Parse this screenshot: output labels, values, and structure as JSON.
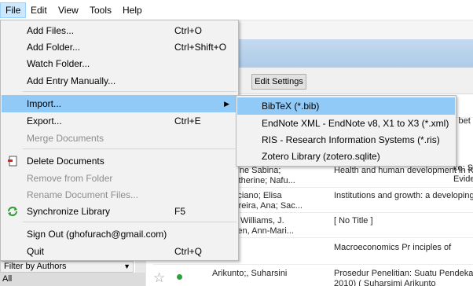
{
  "menubar": {
    "items": [
      {
        "label": "File"
      },
      {
        "label": "Edit"
      },
      {
        "label": "View"
      },
      {
        "label": "Tools"
      },
      {
        "label": "Help"
      }
    ]
  },
  "toolbar": {
    "edit_settings_label": "Edit Settings"
  },
  "file_menu": {
    "items": [
      {
        "label": "Add Files...",
        "shortcut": "Ctrl+O"
      },
      {
        "label": "Add Folder...",
        "shortcut": "Ctrl+Shift+O"
      },
      {
        "label": "Watch Folder...",
        "shortcut": ""
      },
      {
        "label": "Add Entry Manually...",
        "shortcut": ""
      },
      {
        "label": "Import...",
        "shortcut": ""
      },
      {
        "label": "Export...",
        "shortcut": "Ctrl+E"
      },
      {
        "label": "Merge Documents",
        "shortcut": ""
      },
      {
        "label": "Delete Documents",
        "shortcut": ""
      },
      {
        "label": "Remove from Folder",
        "shortcut": ""
      },
      {
        "label": "Rename Document Files...",
        "shortcut": ""
      },
      {
        "label": "Synchronize Library",
        "shortcut": "F5"
      },
      {
        "label": "Sign Out (ghofurach@gmail.com)",
        "shortcut": ""
      },
      {
        "label": "Quit",
        "shortcut": "Ctrl+Q"
      }
    ]
  },
  "import_submenu": {
    "items": [
      {
        "label": "BibTeX (*.bib)"
      },
      {
        "label": "EndNote XML - EndNote v8, X1 to X3 (*.xml)"
      },
      {
        "label": "RIS - Research Information Systems (*.ris)"
      },
      {
        "label": "Zotero Library (zotero.sqlite)"
      }
    ]
  },
  "peek": {
    "row0_title": "k bet",
    "row1_title_a": "ce: S",
    "row1_title_b": "Evide"
  },
  "table": {
    "rows": [
      {
        "authors_1": ", Caroline Sabina;",
        "authors_2": "lise Catherine; Nafu...",
        "title_1": "Health and human development in Ken",
        "title_2": ""
      },
      {
        "authors_1": "shi, Luciano; Elisa",
        "authors_2": "ves Pereira, Ana; Sac...",
        "title_1": "Institutions and growth: a developing",
        "title_2": ""
      },
      {
        "authors_1": "h, Tim; Williams, J.",
        "authors_2": ".; Golden, Ann-Mari...",
        "title_1": "[ No Title ]",
        "title_2": ""
      },
      {
        "authors_1": "",
        "authors_2": "",
        "title_1": "Macroeconomics Pr inciples of",
        "title_2": ""
      },
      {
        "authors_1": "Arikunto;, Suharsini",
        "authors_2": "",
        "title_1": "Prosedur Penelitian: Suatu Pendekatan",
        "title_2": "2010) ( Suharsimi Arikunto"
      }
    ]
  },
  "left_panel": {
    "filter_label": "Filter by Authors",
    "list_first": "All"
  },
  "colors": {
    "highlight": "#91c9f7",
    "menubar_open": "#cce8ff",
    "disabled_text": "#8d8d8d",
    "status_green": "#2ba13a"
  }
}
